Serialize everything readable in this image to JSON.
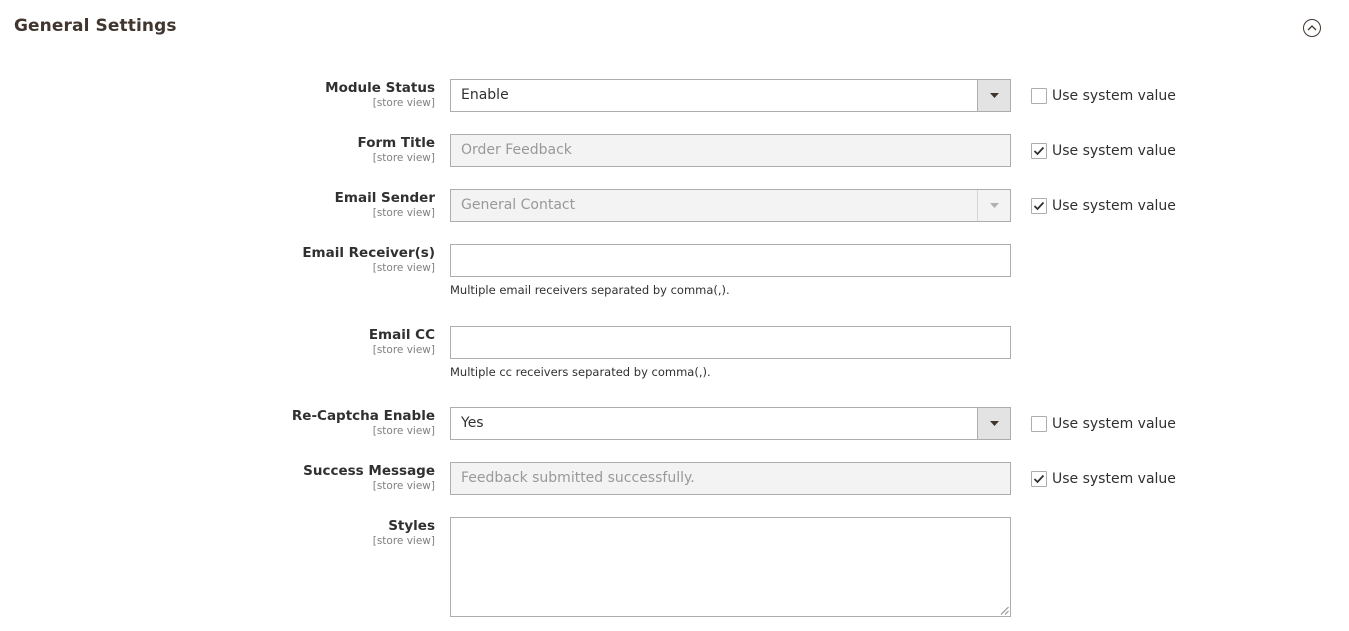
{
  "section": {
    "title": "General Settings",
    "toggle_icon": "chevron-up-circle-icon"
  },
  "fields": {
    "module_status": {
      "label": "Module Status",
      "scope": "[store view]",
      "value": "Enable",
      "use_system_label": "Use system value",
      "use_system_checked": false
    },
    "form_title": {
      "label": "Form Title",
      "scope": "[store view]",
      "placeholder": "Order Feedback",
      "use_system_label": "Use system value",
      "use_system_checked": true
    },
    "email_sender": {
      "label": "Email Sender",
      "scope": "[store view]",
      "value": "General Contact",
      "use_system_label": "Use system value",
      "use_system_checked": true
    },
    "email_receivers": {
      "label": "Email Receiver(s)",
      "scope": "[store view]",
      "value": "",
      "note": "Multiple email receivers separated by comma(,)."
    },
    "email_cc": {
      "label": "Email CC",
      "scope": "[store view]",
      "value": "",
      "note": "Multiple cc receivers separated by comma(,)."
    },
    "recaptcha_enable": {
      "label": "Re-Captcha Enable",
      "scope": "[store view]",
      "value": "Yes",
      "use_system_label": "Use system value",
      "use_system_checked": false
    },
    "success_message": {
      "label": "Success Message",
      "scope": "[store view]",
      "placeholder": "Feedback submitted successfully.",
      "use_system_label": "Use system value",
      "use_system_checked": true
    },
    "styles": {
      "label": "Styles",
      "scope": "[store view]",
      "value": ""
    }
  },
  "colors": {
    "border": "#adadad",
    "disabled_bg": "#f3f3f3",
    "select_button_bg": "#e3e3e3",
    "scope_text": "#808080"
  }
}
